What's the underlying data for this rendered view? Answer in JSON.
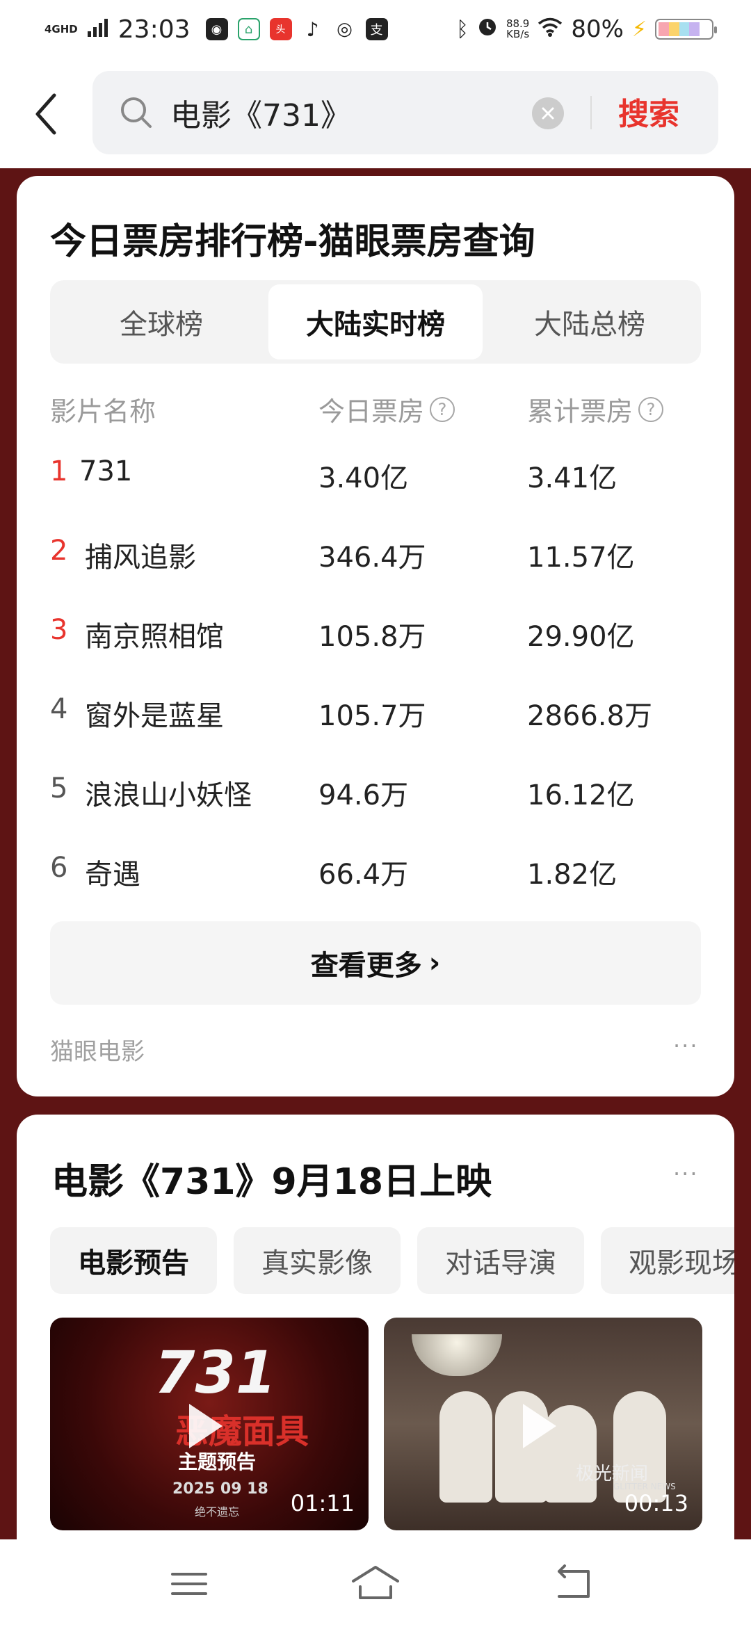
{
  "status_bar": {
    "network": "4GHD",
    "time": "23:03",
    "speed_value": "88.9",
    "speed_unit": "KB/s",
    "battery": "80%"
  },
  "search": {
    "query": "电影《731》",
    "button_label": "搜索"
  },
  "box_office": {
    "title": "今日票房排行榜-猫眼票房查询",
    "tabs": [
      {
        "label": "全球榜",
        "active": false
      },
      {
        "label": "大陆实时榜",
        "active": true
      },
      {
        "label": "大陆总榜",
        "active": false
      }
    ],
    "columns": {
      "name": "影片名称",
      "today": "今日票房",
      "total": "累计票房",
      "help": "?"
    },
    "rows": [
      {
        "rank": "1",
        "name": "731",
        "today": "3.40亿",
        "total": "3.41亿"
      },
      {
        "rank": "2",
        "name": "捕风追影",
        "today": "346.4万",
        "total": "11.57亿"
      },
      {
        "rank": "3",
        "name": "南京照相馆",
        "today": "105.8万",
        "total": "29.90亿"
      },
      {
        "rank": "4",
        "name": "窗外是蓝星",
        "today": "105.7万",
        "total": "2866.8万"
      },
      {
        "rank": "5",
        "name": "浪浪山小妖怪",
        "today": "94.6万",
        "total": "16.12亿"
      },
      {
        "rank": "6",
        "name": "奇遇",
        "today": "66.4万",
        "total": "1.82亿"
      }
    ],
    "more_label": "查看更多",
    "more_arrow": "›",
    "source": "猫眼电影",
    "menu_dots": "···"
  },
  "movie_card": {
    "title": "电影《731》9月18日上映",
    "menu_dots": "···",
    "chips": [
      {
        "label": "电影预告",
        "active": true
      },
      {
        "label": "真实影像",
        "active": false
      },
      {
        "label": "对话导演",
        "active": false
      },
      {
        "label": "观影现场",
        "active": false
      }
    ],
    "videos": [
      {
        "duration": "01:11",
        "poster_title": "731",
        "poster_subtitle": "恶魔面具",
        "poster_tag": "主题预告",
        "poster_date": "2025 09 18",
        "poster_small": "绝不遗忘"
      },
      {
        "duration": "00:13",
        "watermark": "极光新闻",
        "watermark_sub": "GLITTER NEWS"
      }
    ]
  }
}
